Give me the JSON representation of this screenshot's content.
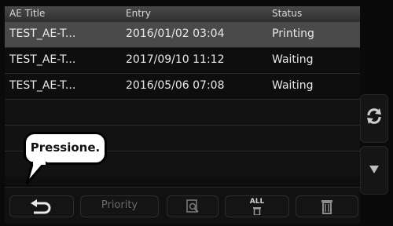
{
  "table": {
    "headers": [
      "AE Title",
      "Entry",
      "Status"
    ],
    "rows": [
      {
        "ae_title": "TEST_AE-T...",
        "entry": "2016/01/02 03:04",
        "status": "Printing"
      },
      {
        "ae_title": "TEST_AE-T...",
        "entry": "2017/09/10 11:12",
        "status": "Waiting"
      },
      {
        "ae_title": "TEST_AE-T...",
        "entry": "2016/05/06 07:08",
        "status": "Waiting"
      }
    ]
  },
  "bottom": {
    "priority_label": "Priority",
    "all_label": "ALL"
  },
  "callout": {
    "text": "Pressione."
  },
  "icons": {
    "back": "return-arrow-icon",
    "refresh": "refresh-icon",
    "scroll_down": "triangle-down-icon",
    "preview": "magnifier-document-icon",
    "delete_all": "trash-all-icon",
    "delete": "trash-icon"
  },
  "colors": {
    "background": "#0a0a0a",
    "header": "#3a3a3a",
    "selected_row": "#4a4a4a",
    "text": "#e9e9e9"
  }
}
